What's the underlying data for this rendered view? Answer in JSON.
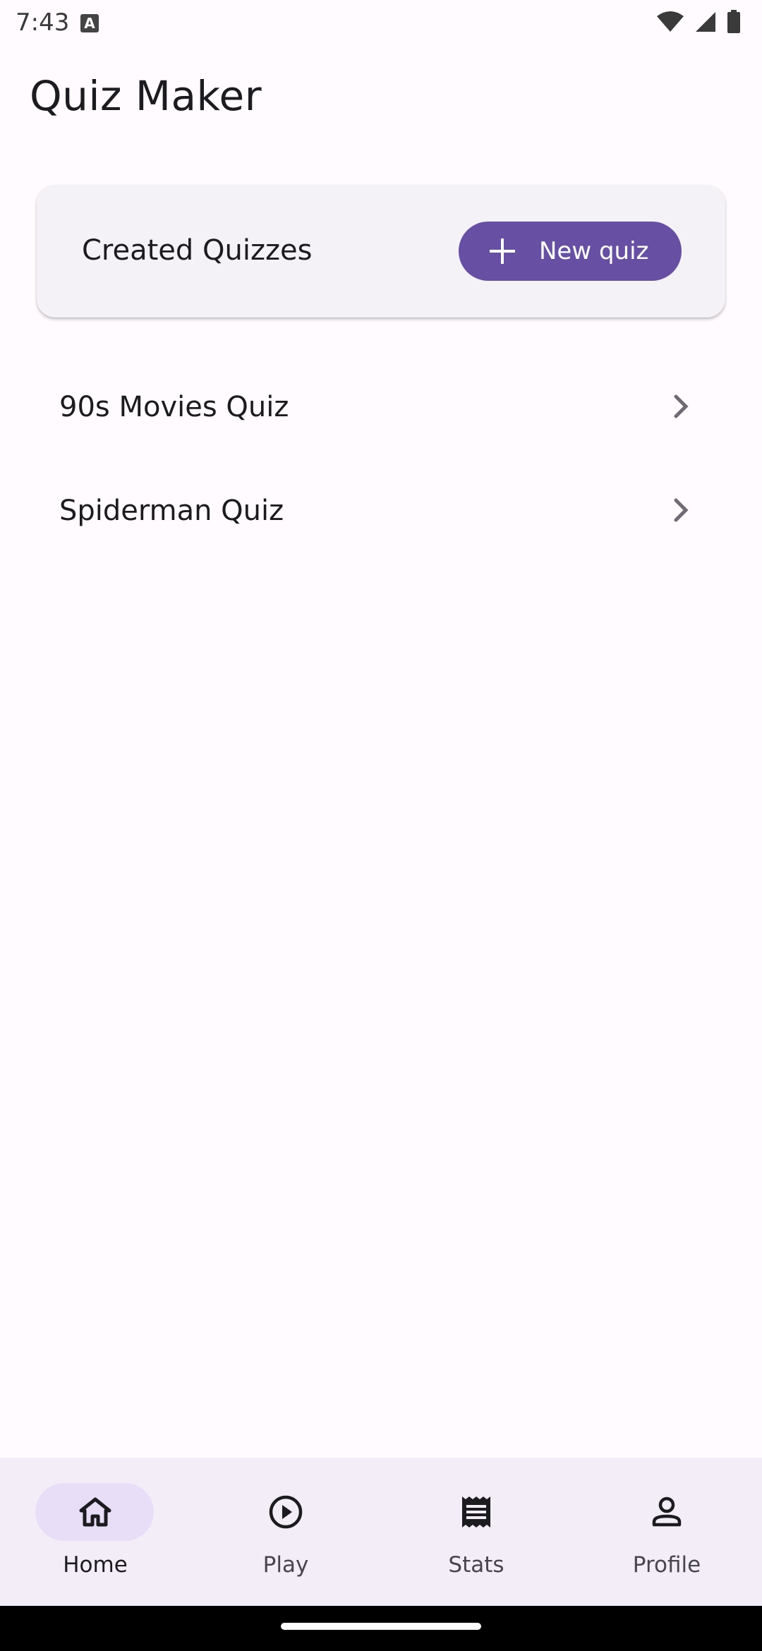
{
  "status_bar": {
    "time": "7:43",
    "notification_letter": "A"
  },
  "app": {
    "title": "Quiz Maker"
  },
  "header_card": {
    "title": "Created Quizzes",
    "new_quiz_label": "New quiz"
  },
  "quizzes": [
    {
      "label": "90s Movies Quiz"
    },
    {
      "label": "Spiderman Quiz"
    }
  ],
  "bottom_nav": {
    "items": [
      {
        "label": "Home",
        "icon": "home-icon",
        "active": true
      },
      {
        "label": "Play",
        "icon": "play-icon",
        "active": false
      },
      {
        "label": "Stats",
        "icon": "receipt-icon",
        "active": false
      },
      {
        "label": "Profile",
        "icon": "person-icon",
        "active": false
      }
    ]
  },
  "colors": {
    "primary": "#6750a4",
    "background": "#fffbfe",
    "card": "#f4f1f7",
    "nav_background": "#f3edf7",
    "active_indicator": "#e8def8"
  }
}
